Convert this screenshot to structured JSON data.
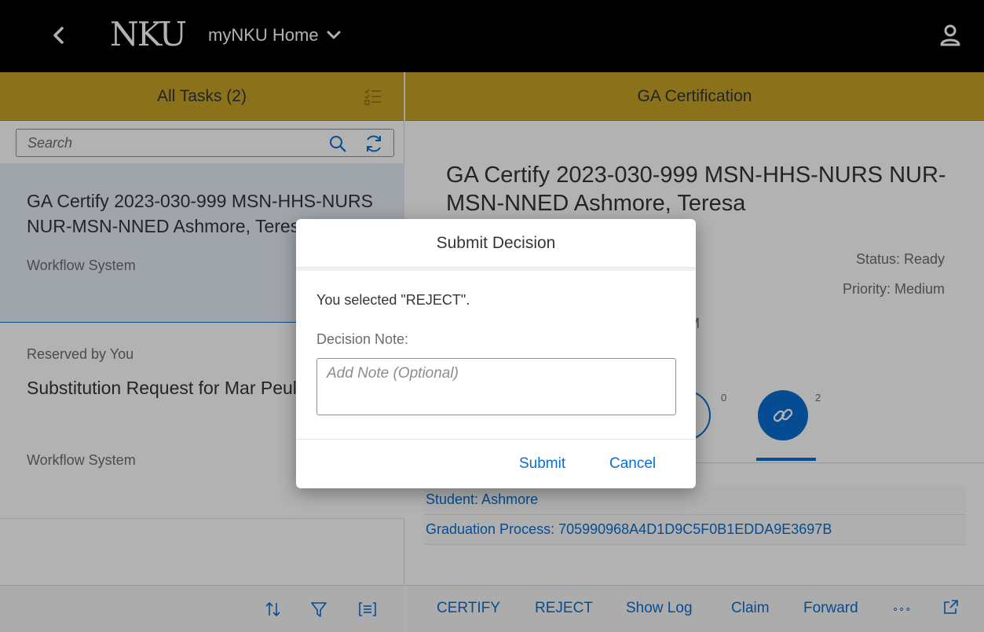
{
  "shell": {
    "logo_text": "NKU",
    "app_title": "myNKU Home",
    "icons": {
      "back": "chevron-left-icon",
      "title_menu": "chevron-down-icon",
      "user": "user-icon"
    }
  },
  "master": {
    "header_title": "All Tasks (2)",
    "search": {
      "placeholder": "Search"
    },
    "items": [
      {
        "title": "GA Certify 2023-030-999 MSN-HHS-NURS NUR-MSN-NNED Ashmore, Teresa",
        "subtitle": "Workflow System"
      },
      {
        "reserved": "Reserved by You",
        "title": "Substitution Request for Mar Peul",
        "subtitle": "Workflow System"
      }
    ],
    "footer_icons": [
      "sort-icon",
      "filter-icon",
      "group-icon"
    ]
  },
  "detail": {
    "header_title": "GA Certification",
    "title": "GA Certify 2023-030-999 MSN-HHS-NURS NUR-MSN-NNED Ashmore, Teresa",
    "status": "Status: Ready",
    "priority": "Priority: Medium",
    "date_fragment": "M",
    "tabs": [
      {
        "icon": "comment-icon",
        "count": "0"
      },
      {
        "icon": "attachment-link-icon",
        "count": "2"
      }
    ],
    "links": [
      "Student: Ashmore",
      "Graduation Process: 705990968A4D1D9C5F0B1EDDA9E3697B"
    ],
    "footer_buttons": {
      "certify": "CERTIFY",
      "reject": "REJECT",
      "show_log": "Show Log",
      "claim": "Claim",
      "forward": "Forward",
      "more": "∘∘∘"
    }
  },
  "dialog": {
    "title": "Submit Decision",
    "message": "You selected \"REJECT\".",
    "note_label": "Decision Note:",
    "note_placeholder": "Add Note (Optional)",
    "submit_label": "Submit",
    "cancel_label": "Cancel"
  },
  "colors": {
    "shell_bg": "#000000",
    "header_gold": "#c9a227",
    "accent_blue": "#0a6ed1",
    "selected_item_bg": "#e5edf5",
    "text": "#32363a",
    "muted_text": "#6a6d70"
  }
}
